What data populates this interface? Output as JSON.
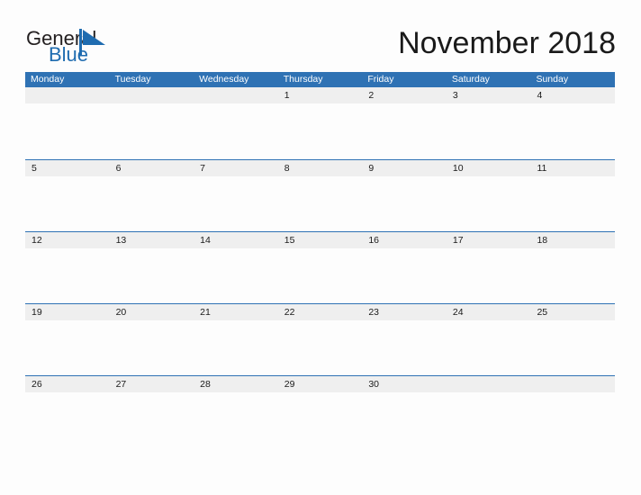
{
  "brand": {
    "logo_word_one": "General",
    "logo_word_two": "Blue",
    "logo_icon": "blue-flag-triangle",
    "color_dark": "#231f20",
    "color_blue": "#1f6cb0"
  },
  "header": {
    "title": "November 2018"
  },
  "theme": {
    "header_blue": "#2f72b4",
    "rule_blue": "#2f72b4",
    "date_band_gray": "#efefef",
    "page_background": "#fdfdfd",
    "text_dark": "#1a1a1a"
  },
  "calendar": {
    "month": "November",
    "year": "2018",
    "weekday_headers": [
      "Monday",
      "Tuesday",
      "Wednesday",
      "Thursday",
      "Friday",
      "Saturday",
      "Sunday"
    ],
    "weeks": [
      [
        "",
        "",
        "",
        "1",
        "2",
        "3",
        "4"
      ],
      [
        "5",
        "6",
        "7",
        "8",
        "9",
        "10",
        "11"
      ],
      [
        "12",
        "13",
        "14",
        "15",
        "16",
        "17",
        "18"
      ],
      [
        "19",
        "20",
        "21",
        "22",
        "23",
        "24",
        "25"
      ],
      [
        "26",
        "27",
        "28",
        "29",
        "30",
        "",
        ""
      ]
    ]
  }
}
